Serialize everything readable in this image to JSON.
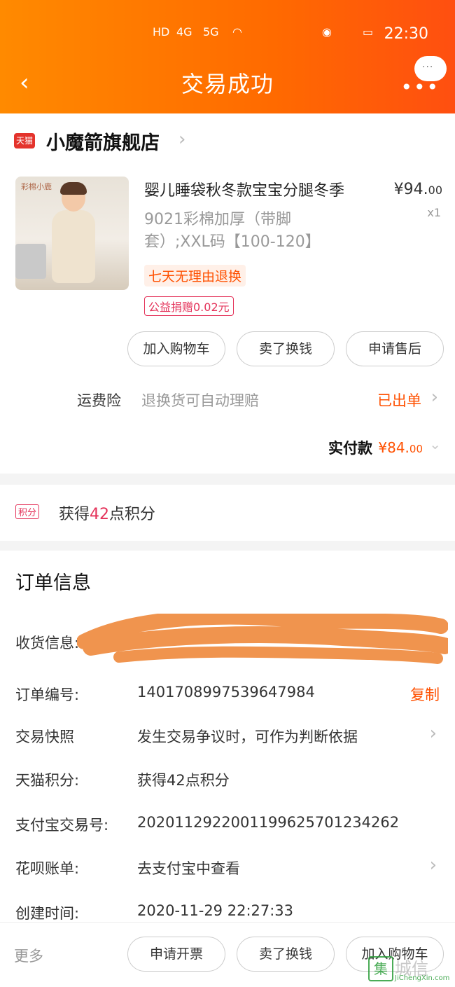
{
  "status_bar": {
    "time": "22:30",
    "signal_label": "HD",
    "network": "4G",
    "network2": "5G"
  },
  "header": {
    "back_icon": "chevron-left-icon",
    "title": "交易成功",
    "more_icon": "more-dots-icon",
    "bubble_text": "···"
  },
  "shop": {
    "badge": "天猫",
    "name": "小魔箭旗舰店",
    "arrow": "›"
  },
  "product": {
    "image_text": "彩棉小鹿",
    "title": "婴儿睡袋秋冬款宝宝分腿冬季",
    "price_int": "¥94.",
    "price_dec": "00",
    "quantity": "x1",
    "sku": "9021彩棉加厚（带脚套）;XXL码【100-120】",
    "tag_return": "七天无理由退换",
    "tag_charity": "公益捐赠0.02元"
  },
  "item_actions": {
    "add_cart": "加入购物车",
    "resell": "卖了换钱",
    "after_sale": "申请售后"
  },
  "insurance": {
    "label": "运费险",
    "desc": "退换货可自动理赔",
    "status": "已出单",
    "arrow": "›"
  },
  "paid": {
    "label": "实付款",
    "price_int": "¥84.",
    "price_dec": "00",
    "chevron": "⌄"
  },
  "points": {
    "badge": "积分",
    "prefix": "获得",
    "number": "42",
    "suffix": "点积分"
  },
  "order_info": {
    "title": "订单信息",
    "rows": {
      "address_label": "收货信息:",
      "order_no_label": "订单编号:",
      "order_no": "1401708997539647984",
      "copy": "复制",
      "snapshot_label": "交易快照",
      "snapshot_value": "发生交易争议时，可作为判断依据",
      "tmall_points_label": "天猫积分:",
      "tmall_points_value": "获得42点积分",
      "alipay_label": "支付宝交易号:",
      "alipay_value": "2020112922001199625701234262",
      "huabei_label": "花呗账单:",
      "huabei_value": "去支付宝中查看",
      "created_label": "创建时间:",
      "created_value": "2020-11-29 22:27:33",
      "arrow": "›"
    }
  },
  "bottom_bar": {
    "more": "更多",
    "invoice": "申请开票",
    "resell": "卖了换钱",
    "add_cart": "加入购物车"
  },
  "watermark": {
    "box": "集",
    "text": "城信",
    "url": "JiChengXin.com"
  },
  "colors": {
    "header_start": "#ff8a00",
    "header_end": "#ff4f10",
    "accent": "#ff5000",
    "tmall_red": "#e4332c",
    "redaction": "#f0944e"
  }
}
